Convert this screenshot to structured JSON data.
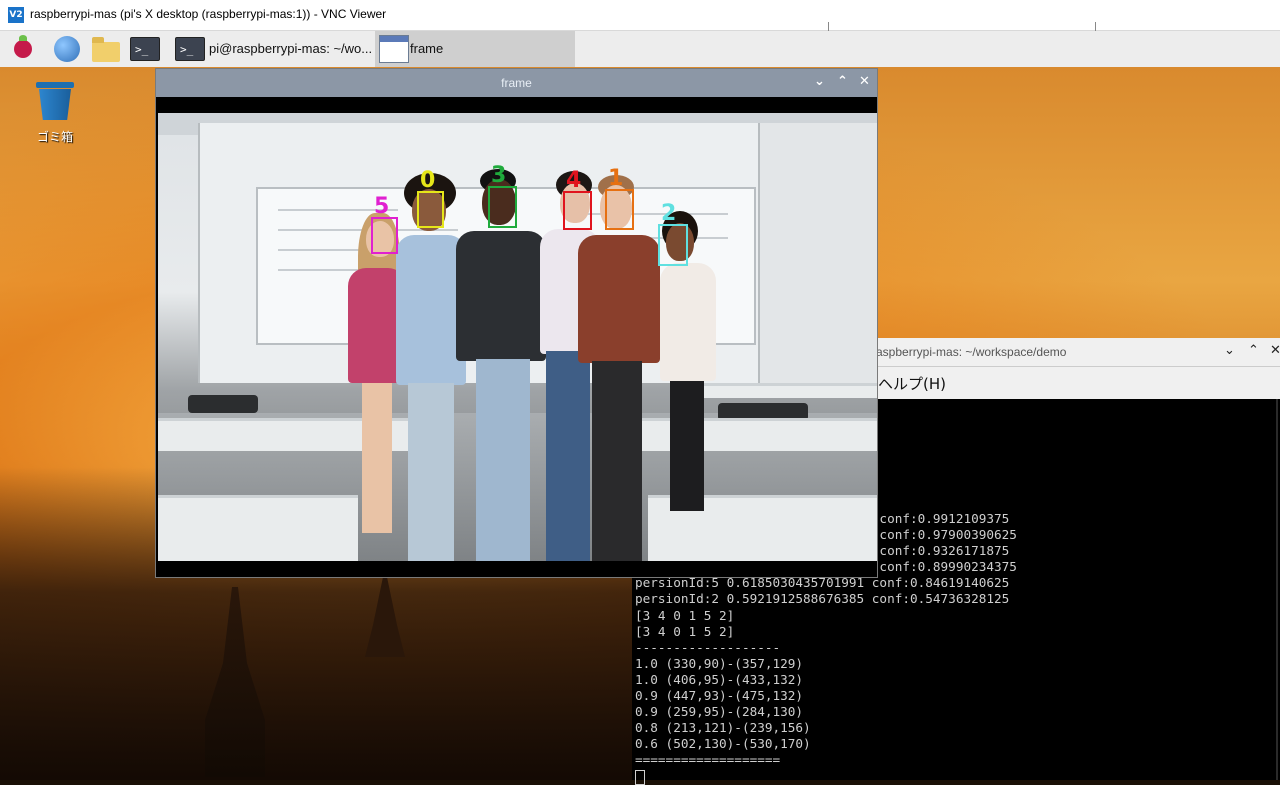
{
  "vnc": {
    "title": "raspberrypi-mas (pi's X desktop (raspberrypi-mas:1)) - VNC Viewer",
    "logo": "V2"
  },
  "panel": {
    "menu_icon": "raspberry-icon",
    "terminal_task_label": "pi@raspberrypi-mas: ~/wo...",
    "terminal_glyph": ">_",
    "frame_task_label": "frame"
  },
  "desktop": {
    "trash_label": "ゴミ箱"
  },
  "frame_window": {
    "title": "frame",
    "controls": {
      "minimize": "⌄",
      "maximize": "⌃",
      "close": "✕"
    },
    "detections": [
      {
        "id": "0",
        "color": "#e6e619"
      },
      {
        "id": "1",
        "color": "#e67012"
      },
      {
        "id": "2",
        "color": "#5fe0e0"
      },
      {
        "id": "3",
        "color": "#1faa3c"
      },
      {
        "id": "4",
        "color": "#e0141e"
      },
      {
        "id": "5",
        "color": "#e020d0"
      }
    ]
  },
  "terminal_window": {
    "title": "raspberrypi-mas: ~/workspace/demo",
    "controls": {
      "minimize": "⌄",
      "maximize": "⌃",
      "close": "✕"
    },
    "menu_help": "ヘルプ(H)",
    "lines": [
      "                                conf:0.9912109375",
      "                                conf:0.97900390625",
      "                                conf:0.9326171875",
      "                                conf:0.89990234375",
      "persionId:5 0.6185030435701991 conf:0.84619140625",
      "persionId:2 0.5921912588676385 conf:0.54736328125",
      "[3 4 0 1 5 2]",
      "[3 4 0 1 5 2]",
      "-------------------",
      "1.0 (330,90)-(357,129)",
      "1.0 (406,95)-(433,132)",
      "0.9 (447,93)-(475,132)",
      "0.9 (259,95)-(284,130)",
      "0.8 (213,121)-(239,156)",
      "0.6 (502,130)-(530,170)",
      "==================="
    ]
  }
}
